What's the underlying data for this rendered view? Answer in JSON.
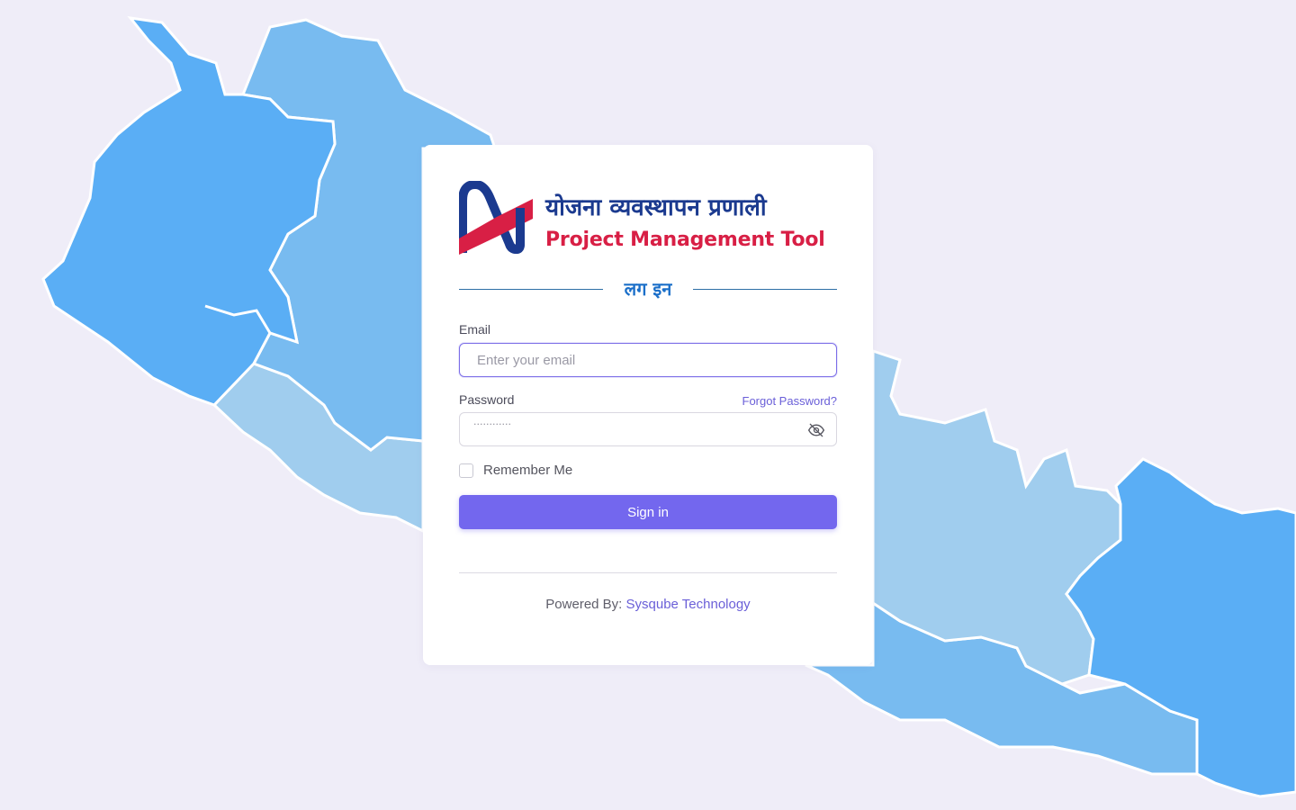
{
  "colors": {
    "background": "#efedf8",
    "map_dark": "#5aaef5",
    "map_mid": "#78bbf0",
    "map_light": "#a0cdee",
    "primary": "#7367ee",
    "link": "#6a5fd8",
    "logo_blue": "#1b3a8f",
    "logo_red": "#d81f45"
  },
  "logo": {
    "nepali_text": "योजना व्यवस्थापन प्रणाली",
    "english_text": "Project Management Tool"
  },
  "login": {
    "heading": "लग इन",
    "email_label": "Email",
    "email_placeholder": "Enter your email",
    "password_label": "Password",
    "forgot_password": "Forgot Password?",
    "password_mask": "············",
    "show_password_icon": "eye-off-icon",
    "remember_me": "Remember Me",
    "sign_in": "Sign in"
  },
  "footer": {
    "powered_prefix": "Powered By:",
    "powered_link": "Sysqube Technology"
  }
}
